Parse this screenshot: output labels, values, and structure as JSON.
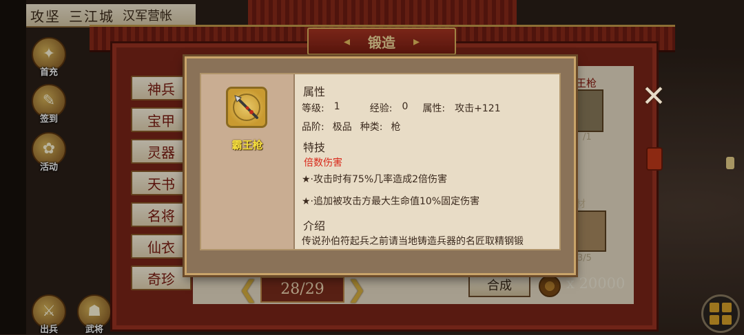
{
  "breadcrumb": {
    "item1": "攻坚",
    "item2": "三江城",
    "item3": "汉军营帐"
  },
  "side_nav": [
    {
      "label": "首充",
      "icon": "first-recharge-icon"
    },
    {
      "label": "签到",
      "icon": "sign-in-icon"
    },
    {
      "label": "活动",
      "icon": "event-icon"
    },
    {
      "label": "出兵",
      "icon": "deploy-icon"
    },
    {
      "label": "武将",
      "icon": "general-icon"
    }
  ],
  "forge": {
    "title": "锻造",
    "categories": [
      "神兵",
      "宝甲",
      "灵器",
      "天书",
      "名将",
      "仙衣",
      "奇珍"
    ],
    "pager": {
      "current": "28/29"
    },
    "compose_label": "合成",
    "cost": "x 20000",
    "right": {
      "name_partial": "王枪",
      "count1": "/1",
      "material_label": "材",
      "count2": "3/5"
    }
  },
  "detail": {
    "item_name": "霸王枪",
    "attr_header": "属性",
    "level_label": "等级:",
    "level_value": "1",
    "exp_label": "经验:",
    "exp_value": "0",
    "attr_label": "属性:",
    "attr_value": "攻击+121",
    "grade_label": "品阶:",
    "grade_value": "极品",
    "type_label": "种类:",
    "type_value": "枪",
    "skill_header": "特技",
    "skill_name": "倍数伤害",
    "skill_lines": [
      "★·攻击时有75%几率造成2倍伤害",
      "★·追加被攻击方最大生命值10%固定伤害"
    ],
    "intro_header": "介绍",
    "intro_text": "传说孙伯符起兵之前请当地铸造兵器的名匠取精钢锻"
  },
  "colors": {
    "frame_red": "#7a2418",
    "parchment": "#e8dcc6",
    "item_name_yellow": "#f6e040",
    "skill_red": "#d8281a"
  }
}
